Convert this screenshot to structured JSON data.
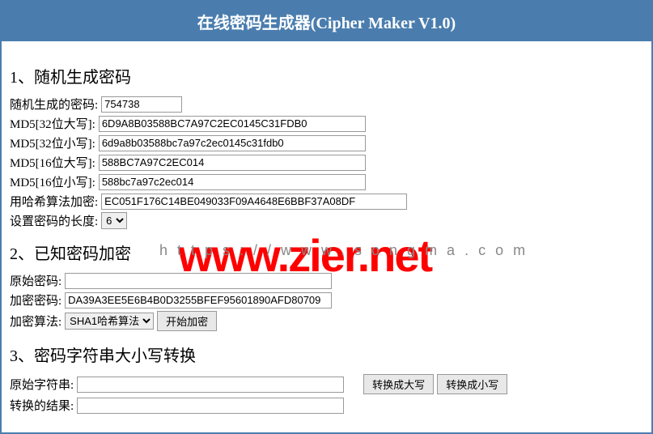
{
  "header": {
    "title": "在线密码生成器(Cipher Maker V1.0)"
  },
  "section1": {
    "title": "1、随机生成密码",
    "random_label": "随机生成的密码:",
    "random_value": "754738",
    "md5_32u_label": "MD5[32位大写]:",
    "md5_32u_value": "6D9A8B03588BC7A97C2EC0145C31FDB0",
    "md5_32l_label": "MD5[32位小写]:",
    "md5_32l_value": "6d9a8b03588bc7a97c2ec0145c31fdb0",
    "md5_16u_label": "MD5[16位大写]:",
    "md5_16u_value": "588BC7A97C2EC014",
    "md5_16l_label": "MD5[16位小写]:",
    "md5_16l_value": "588bc7a97c2ec014",
    "hash_label": "用哈希算法加密:",
    "hash_value": "EC051F176C14BE049033F09A4648E6BBF37A08DF",
    "length_label": "设置密码的长度:",
    "length_value": "6"
  },
  "section2": {
    "title": "2、已知密码加密",
    "orig_label": "原始密码:",
    "orig_value": "",
    "enc_label": "加密密码:",
    "enc_value": "DA39A3EE5E6B4B0D3255BFEF95601890AFD80709",
    "algo_label": "加密算法:",
    "algo_value": "SHA1哈希算法",
    "button": "开始加密"
  },
  "section3": {
    "title": "3、密码字符串大小写转换",
    "orig_label": "原始字符串:",
    "orig_value": "",
    "result_label": "转换的结果:",
    "result_value": "",
    "btn_upper": "转换成大写",
    "btn_lower": "转换成小写"
  },
  "watermark": {
    "url": "https://www.songma.com",
    "brand": "www.zier.net"
  }
}
